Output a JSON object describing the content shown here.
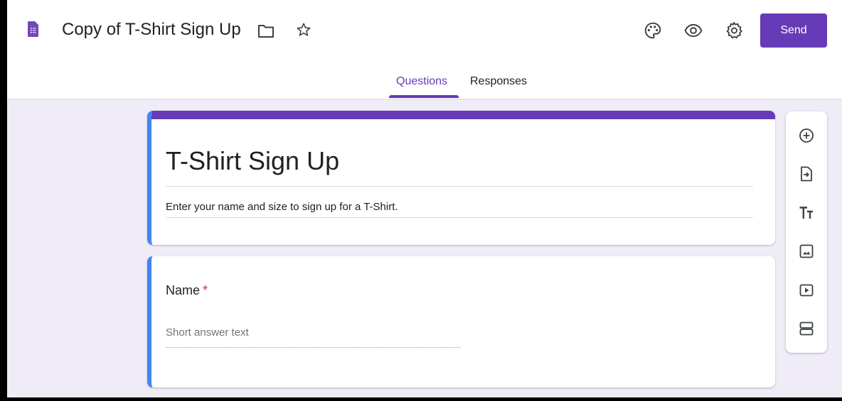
{
  "app": {
    "doc_title": "Copy of T-Shirt Sign Up",
    "send_label": "Send"
  },
  "tabs": [
    {
      "label": "Questions",
      "active": true
    },
    {
      "label": "Responses",
      "active": false
    }
  ],
  "form": {
    "title": "T-Shirt Sign Up",
    "description": "Enter your name and size to sign up for a T-Shirt."
  },
  "question": {
    "title": "Name",
    "required_mark": "*",
    "answer_placeholder": "Short answer text"
  },
  "header_icons": [
    "folder-icon",
    "star-icon",
    "palette-icon",
    "eye-icon",
    "gear-icon"
  ],
  "toolbar_icons": [
    "add-question-icon",
    "import-questions-icon",
    "title-text-icon",
    "image-icon",
    "video-icon",
    "section-icon"
  ],
  "colors": {
    "accent": "#673ab7",
    "focus_bar": "#4285f4",
    "background": "#efebf7",
    "required": "#d93025"
  }
}
